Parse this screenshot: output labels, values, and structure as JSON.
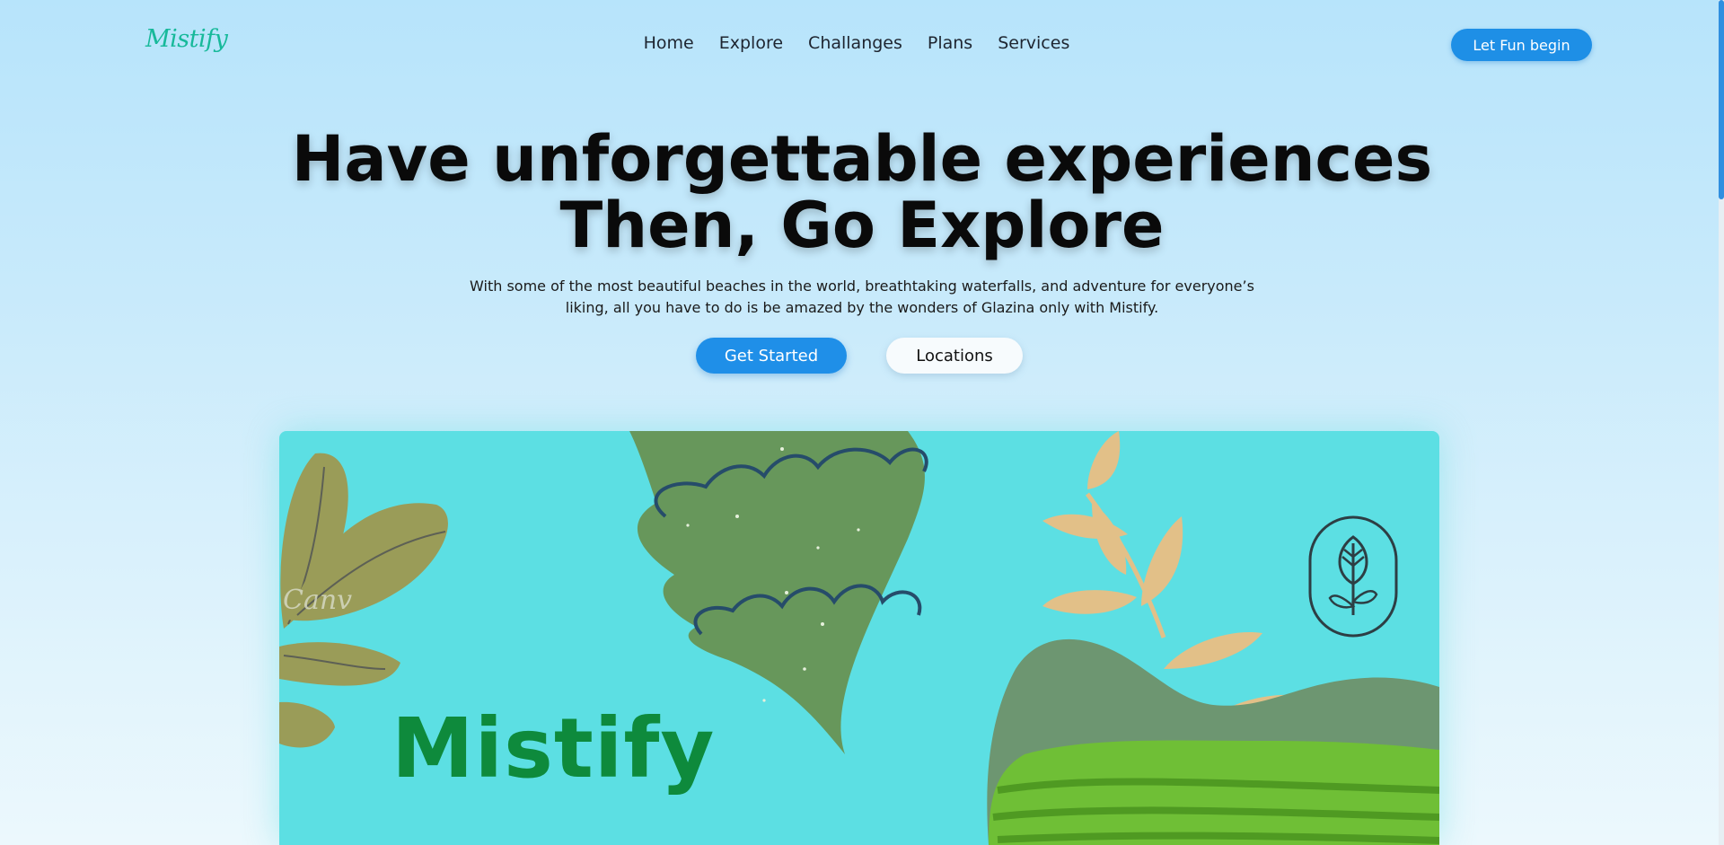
{
  "brand": {
    "logo_text": "Mistify",
    "logo_color": "#17b99a"
  },
  "nav": {
    "items": [
      {
        "label": "Home"
      },
      {
        "label": "Explore"
      },
      {
        "label": "Challanges"
      },
      {
        "label": "Plans"
      },
      {
        "label": "Services"
      }
    ],
    "cta_label": "Let Fun begin"
  },
  "hero": {
    "title_line1": "Have unforgettable experiences",
    "title_line2": "Then, Go Explore",
    "subtitle": "With some of the most beautiful beaches in the world, breathtaking waterfalls, and adventure for everyone’s liking, all you have to do is be amazed by the wonders of Glazina only with Mistify.",
    "primary_button": "Get Started",
    "secondary_button": "Locations"
  },
  "banner": {
    "brand_word": "Mistify",
    "watermark": "Canv",
    "background_color": "#5cdfe3"
  },
  "colors": {
    "accent": "#1f8fe8",
    "brand_green": "#0e8a3c"
  },
  "icons": [
    "leaf-emblem-icon"
  ]
}
